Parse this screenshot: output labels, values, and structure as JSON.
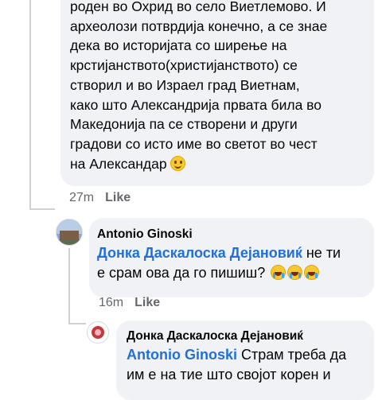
{
  "comment1": {
    "lines": [
      "роден во Охрид во село Виетлемово. И",
      "археолози потврдија конечно, а се знае",
      "дека во историјата со ширење на",
      "крстијанството(христијанството) се",
      "створил и во Израел град Виетнам,",
      "како што Александрија првата била во",
      "Македонија па се створени и други",
      "градови со исто име во светот во чест",
      "на Александар"
    ],
    "emoji": "slightly-smiling-face",
    "time": "27m",
    "like_label": "Like"
  },
  "comment2": {
    "author": "Antonio Ginoski",
    "mention": "Донка Даскалоска Дејановиќ",
    "text_after_mention": " не ти",
    "line2": "е срам ова да го пишиш?",
    "emoji": "face-with-tears-of-joy",
    "time": "16m",
    "like_label": "Like"
  },
  "comment3": {
    "author": "Донка Даскалоска Дејановиќ",
    "mention": "Antonio Ginoski",
    "text_after_mention": " Страм треба да",
    "line2": "им е на тие што својот корен и"
  },
  "colors": {
    "bubble": "#f0f2f5",
    "mention": "#216fdb",
    "meta": "#65676b",
    "thread_line": "#ced0d4"
  }
}
